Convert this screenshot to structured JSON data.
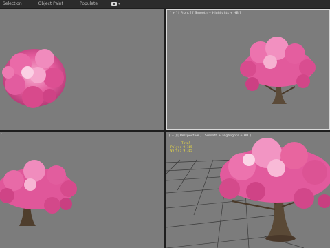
{
  "menubar": {
    "items": [
      {
        "label": "Selection"
      },
      {
        "label": "Object Paint"
      },
      {
        "label": "Populate"
      }
    ]
  },
  "viewports": {
    "top_left": {
      "label": ""
    },
    "top_right": {
      "label": "[ + ] [ Front ] [ Smooth + Highlights + HB ]"
    },
    "bottom_left": {
      "label": "["
    },
    "bottom_right": {
      "label": "[ + ] [ Perspective ] [ Smooth + Highlights + HB ]"
    }
  },
  "stats": {
    "heading": "Total",
    "polys_label": "Polys:",
    "polys_value": "9,165",
    "verts_label": "Verts:",
    "verts_value": "9,165"
  },
  "colors": {
    "viewport_bg": "#7c7c7c",
    "blossom": "#e8559a",
    "blossom_light": "#f29bc6",
    "trunk": "#4a3a2a",
    "stats_text": "#f0e040",
    "active_border": "#d9d9d9"
  }
}
